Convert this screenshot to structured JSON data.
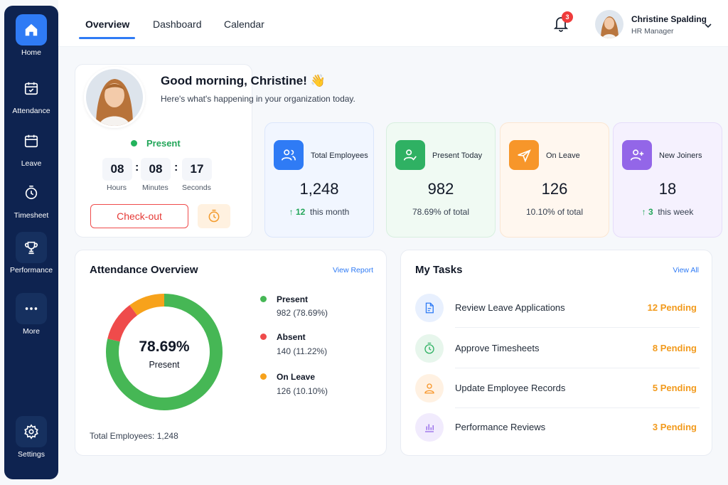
{
  "sidebar": {
    "items": [
      {
        "label": "Home",
        "icon": "home-icon"
      },
      {
        "label": "Attendance",
        "icon": "calendar-check-icon"
      },
      {
        "label": "Leave",
        "icon": "calendar-icon"
      },
      {
        "label": "Timesheet",
        "icon": "stopwatch-icon"
      },
      {
        "label": "Performance",
        "icon": "trophy-icon"
      },
      {
        "label": "More",
        "icon": "more-dots-icon"
      },
      {
        "label": "Settings",
        "icon": "gear-icon"
      }
    ]
  },
  "header": {
    "tabs": [
      {
        "label": "Overview"
      },
      {
        "label": "Dashboard"
      },
      {
        "label": "Calendar"
      }
    ],
    "notifications": "3",
    "user_name": "Christine Spalding",
    "user_role": "HR Manager"
  },
  "welcome": {
    "greeting": "Good morning, Christine! 👋",
    "subtitle": "Here's what's happening in your organization today.",
    "status": "Present",
    "hours": "08",
    "minutes": "08",
    "seconds": "17",
    "hours_label": "Hours",
    "minutes_label": "Minutes",
    "seconds_label": "Seconds",
    "checkout_label": "Check-out"
  },
  "stats": [
    {
      "label": "Total Employees",
      "value": "1,248",
      "sub_arrow": "↑ 12",
      "sub": "this month",
      "color": "#2f7bf5",
      "icon": "users-icon"
    },
    {
      "label": "Present Today",
      "value": "982",
      "sub_arrow": "",
      "sub": "78.69% of total",
      "color": "#2fb163",
      "icon": "user-check-icon"
    },
    {
      "label": "On Leave",
      "value": "126",
      "sub_arrow": "",
      "sub": "10.10% of total",
      "color": "#f7962a",
      "icon": "plane-icon"
    },
    {
      "label": "New Joiners",
      "value": "18",
      "sub_arrow": "↑ 3",
      "sub": "this week",
      "color": "#9366e8",
      "icon": "user-plus-icon"
    }
  ],
  "attendance": {
    "title": "Attendance Overview",
    "link": "View Report",
    "center_pct": "78.69%",
    "center_label": "Present",
    "total": "Total Employees: 1,248",
    "legend": [
      {
        "name": "Present",
        "value": "982 (78.69%)",
        "color": "#46b755"
      },
      {
        "name": "Absent",
        "value": "140 (11.22%)",
        "color": "#ef4b4b"
      },
      {
        "name": "On Leave",
        "value": "126 (10.10%)",
        "color": "#f7a21b"
      }
    ],
    "shares": [
      78.69,
      11.22,
      10.1
    ]
  },
  "tasks": {
    "title": "My Tasks",
    "link": "View All",
    "items": [
      {
        "name": "Review Leave Applications",
        "count": "12 Pending",
        "icon": "document-icon",
        "color": "#2f7bf5",
        "bg": "#e8f0fe"
      },
      {
        "name": "Approve Timesheets",
        "count": "8 Pending",
        "icon": "stopwatch-icon",
        "color": "#2fb163",
        "bg": "#e7f6ec"
      },
      {
        "name": "Update Employee Records",
        "count": "5 Pending",
        "icon": "user-icon",
        "color": "#f7962a",
        "bg": "#fff1e2"
      },
      {
        "name": "Performance Reviews",
        "count": "3 Pending",
        "icon": "bar-chart-icon",
        "color": "#9366e8",
        "bg": "#f1ebfd"
      }
    ]
  }
}
